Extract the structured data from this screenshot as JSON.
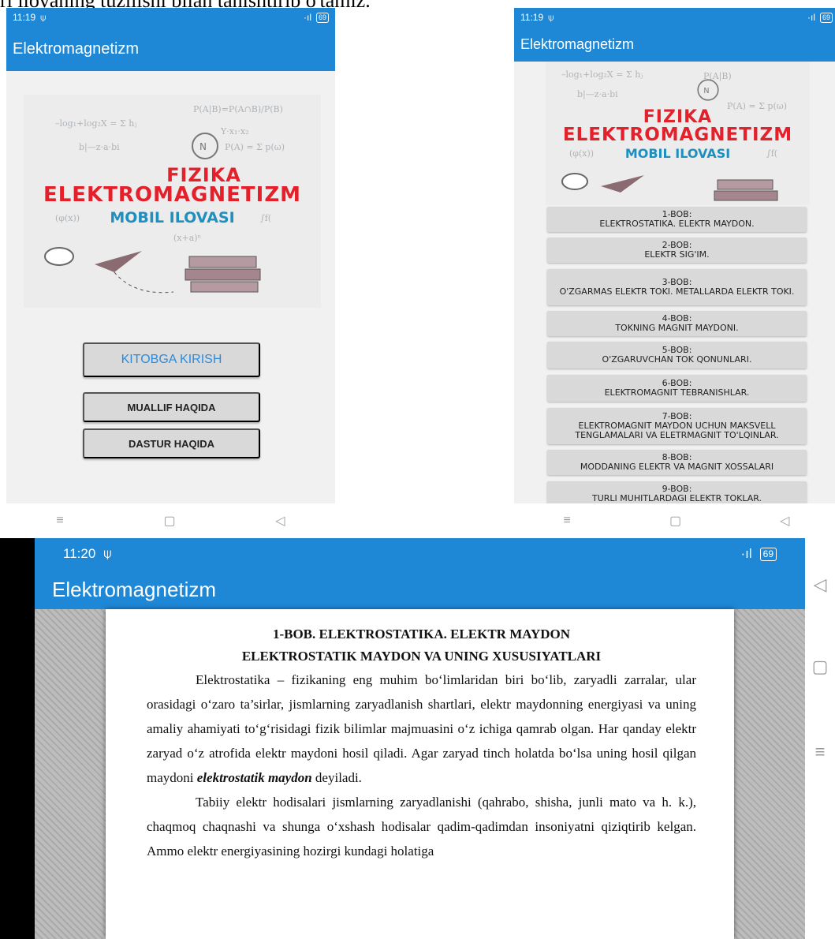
{
  "caption": "ri ilovaning tuzilishi bilan tanishtirib o'tamiz.",
  "phone1": {
    "time": "11:19",
    "battery": "69",
    "title": "Elektromagnetizm",
    "cover": {
      "line1": "FIZIKA",
      "line2": "ELEKTROMAGNETIZM",
      "line3": "MOBIL ILOVASI"
    },
    "buttons": {
      "enter": "KITOBGA KIRISH",
      "author": "MUALLIF HAQIDA",
      "about": "DASTUR HAQIDA"
    }
  },
  "phone2": {
    "time": "11:19",
    "battery": "69",
    "title": "Elektromagnetizm",
    "cover": {
      "line1": "FIZIKA",
      "line2": "ELEKTROMAGNETIZM",
      "line3": "MOBIL ILOVASI"
    },
    "chapters": [
      {
        "num": "1-BOB:",
        "title": "ELEKTROSTATIKA. ELEKTR MAYDON."
      },
      {
        "num": "2-BOB:",
        "title": "ELEKTR SIG'IM."
      },
      {
        "num": "3-BOB:",
        "title": "O'ZGARMAS ELEKTR TOKI. METALLARDA ELEKTR TOKI."
      },
      {
        "num": "4-BOB:",
        "title": "TOKNING MAGNIT MAYDONI."
      },
      {
        "num": "5-BOB:",
        "title": "O'ZGARUVCHAN TOK QONUNLARI."
      },
      {
        "num": "6-BOB:",
        "title": "ELEKTROMAGNIT TEBRANISHLAR."
      },
      {
        "num": "7-BOB:",
        "title": "ELEKTROMAGNIT MAYDON UCHUN MAKSVELL TENGLAMALARI VA ELETRMAGNIT TO'LQINLAR."
      },
      {
        "num": "8-BOB:",
        "title": "MODDANING ELEKTR VA MAGNIT XOSSALARI"
      },
      {
        "num": "9-BOB:",
        "title": "TURLI MUHITLARDAGI ELEKTR TOKLAR."
      }
    ]
  },
  "tablet": {
    "time": "11:20",
    "battery": "69",
    "title": "Elektromagnetizm",
    "heading1": "1-BOB. ELEKTROSTATIKA. ELEKTR MAYDON",
    "heading2": "ELEKTROSTATIK MAYDON VA UNING XUSUSIYATLARI",
    "para1_a": "Elektrostatika – fizikaning eng muhim bo‘limlaridan biri bo‘lib, zaryadli zarralar, ular orasidagi o‘zaro ta’sirlar, jismlarning zaryadlanish shartlari, elektr maydonning energiyasi va uning amaliy ahamiyati to‘g‘risidagi fizik bilimlar majmuasini o‘z ichiga qamrab olgan. Har qanday elektr zaryad o‘z atrofida elektr maydoni hosil qiladi. Agar zaryad tinch holatda bo‘lsa uning hosil  qilgan maydoni ",
    "para1_term": "elektrostatik maydon",
    "para1_b": " deyiladi.",
    "para2": "Tabiiy elektr hodisalari jismlarning zaryadlanishi (qahrabo, shisha, junli mato va h. k.), chaqmoq chaqnashi va shunga o‘xshash hodisalar qadim-qadimdan insoniyatni qiziqtirib kelgan. Ammo elektr energiyasining hozirgi kundagi holatiga"
  },
  "colors": {
    "appbar": "#1e88d6",
    "fizika_red": "#e4202a",
    "mobil_blue": "#1f8fc0",
    "link_blue": "#2a8cdf",
    "button_gray": "#d9d9d9"
  }
}
